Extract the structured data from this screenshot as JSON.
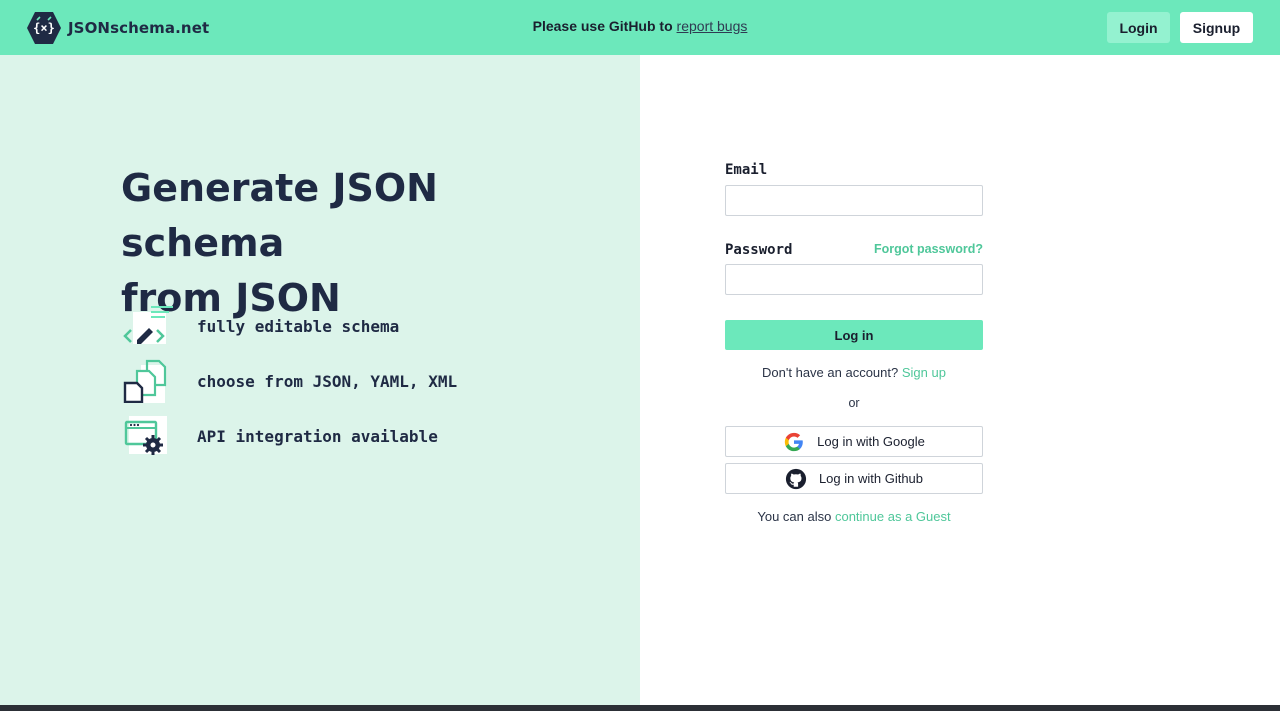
{
  "header": {
    "logo_text": "JSONschema.net",
    "notice_prefix": "Please use GitHub to ",
    "notice_link": "report bugs",
    "login_label": "Login",
    "signup_label": "Signup"
  },
  "hero": {
    "title_line1": "Generate JSON schema",
    "title_line2": "from JSON",
    "features": [
      {
        "label": "fully editable schema",
        "icon": "edit-code-icon"
      },
      {
        "label": "choose from JSON, YAML, XML",
        "icon": "documents-icon"
      },
      {
        "label": "API integration available",
        "icon": "api-settings-icon"
      }
    ]
  },
  "form": {
    "email_label": "Email",
    "email_value": "",
    "password_label": "Password",
    "password_value": "",
    "forgot_label": "Forgot password?",
    "login_button": "Log in",
    "no_account_text": "Don't have an account? ",
    "signup_link": "Sign up",
    "or_text": "or",
    "google_button": "Log in with Google",
    "github_button": "Log in with Github",
    "guest_prefix": "You can also ",
    "guest_link": "continue as a Guest"
  },
  "colors": {
    "accent": "#6ce8bb",
    "accent_light": "#dcf4ea",
    "link": "#4fc79a",
    "navy": "#1f2a44"
  }
}
